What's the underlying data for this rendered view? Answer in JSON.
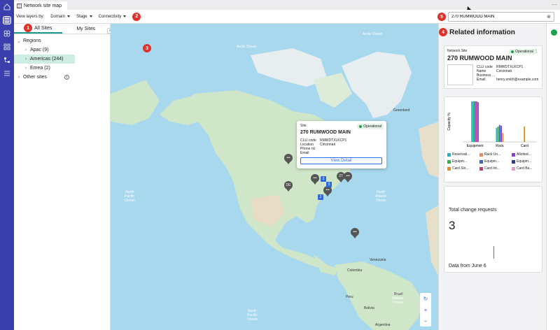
{
  "window": {
    "tab_title": "Network site map",
    "more_label": "···"
  },
  "toolbar": {
    "view_layers_label": "View layers by:",
    "domain_label": "Domain",
    "stage_label": "Stage",
    "connectivity_label": "Connectivity",
    "badge_2": "2",
    "badge_5": "5",
    "search_value": "270 RUMWOOD MAIN",
    "search_clear": "⊗"
  },
  "left_panel": {
    "badge_1": "1",
    "tab_all": "All Sites",
    "tab_my": "My Sites",
    "collapse": "‹",
    "regions_label": "Regions",
    "regions": [
      {
        "label": "Apac (9)"
      },
      {
        "label": "Americas (244)"
      },
      {
        "label": "Emea (2)"
      }
    ],
    "other_sites_label": "Other sites",
    "info_glyph": "i"
  },
  "map": {
    "badge_3": "3",
    "labels": {
      "greenland": "Greenland",
      "north_pacific": "North\nPacific\nOcean",
      "north_atlantic": "North\nAtlantic\nOcean",
      "south_pacific": "South\nPacific\nOcean",
      "south_atlantic": "South\nAtlantic\nOcean",
      "arctic1": "Arctic Ocean",
      "arctic2": "Arctic Ocean",
      "venezuela": "Venezuela",
      "colombia": "Colombia",
      "peru": "Peru",
      "brazil": "Brazil",
      "bolivia": "Bolivia",
      "argentina": "Argentina"
    },
    "pins": [
      {
        "label": "•••"
      },
      {
        "label": "DE"
      },
      {
        "label": "•••"
      },
      {
        "label": "•••"
      },
      {
        "label": "27"
      },
      {
        "label": "•••"
      },
      {
        "label": "•••"
      }
    ],
    "blue_pins": [
      {
        "label": "2"
      },
      {
        "label": "2"
      },
      {
        "label": "2"
      }
    ],
    "popup": {
      "type_label": "Site",
      "status": "Operational",
      "title": "270 RUMWOOD MAIN",
      "clli_label": "CLLI code",
      "clli_value": "RMWDTXLKCP1",
      "location_label": "Location",
      "location_value": "Cincinnati",
      "phone_label": "Phone no",
      "email_label": "Email",
      "view_detail": "View Detail"
    },
    "controls": {
      "refresh": "↻",
      "zoom_in": "+",
      "zoom_out": "−"
    }
  },
  "right_panel": {
    "badge_4": "4",
    "title": "Related information",
    "site_card": {
      "type_label": "Network Site",
      "status": "Operational",
      "kebab": "⋮",
      "name": "270 RUMWOOD MAIN",
      "clli_label": "CLLI code",
      "clli_value": "RMWDTXLKCP1",
      "name_label": "Name",
      "name_value": "Cincinnati",
      "business_label": "Business ...",
      "business_value": "",
      "email_label": "Email",
      "email_value": "henry.smith@example.com"
    },
    "capacity_card": {
      "legend": [
        {
          "label": "Reservati...",
          "color": "#1fb3c4"
        },
        {
          "label": "Rack Un...",
          "color": "#f08a5d"
        },
        {
          "label": "Allotted...",
          "color": "#8c3fd1"
        },
        {
          "label": "Equipm...",
          "color": "#2bb34a"
        },
        {
          "label": "Equipm...",
          "color": "#3a63d9"
        },
        {
          "label": "Equipm...",
          "color": "#2a3f8a"
        },
        {
          "label": "Card Slo...",
          "color": "#e68a1b"
        },
        {
          "label": "Card Int...",
          "color": "#d6336c"
        },
        {
          "label": "Card Ba...",
          "color": "#e59ac3"
        }
      ]
    },
    "change_card": {
      "title": "Total change requests",
      "count": "3",
      "footer": "Data from June 6"
    }
  },
  "chart_data": {
    "type": "bar",
    "categories": [
      "Equipment",
      "Rack",
      "Card"
    ],
    "ylabel": "Capacity %",
    "ylim": [
      0,
      100
    ],
    "series": [
      {
        "name": "Reservati...",
        "values": [
          100,
          35,
          0
        ]
      },
      {
        "name": "Equipm...",
        "values": [
          100,
          38,
          0
        ]
      },
      {
        "name": "Equipm...",
        "values": [
          100,
          42,
          0
        ]
      },
      {
        "name": "Card Int...",
        "values": [
          100,
          0,
          0
        ]
      },
      {
        "name": "Allotted...",
        "values": [
          98,
          40,
          0
        ]
      },
      {
        "name": "Card Slo...",
        "values": [
          0,
          22,
          38
        ]
      }
    ]
  }
}
